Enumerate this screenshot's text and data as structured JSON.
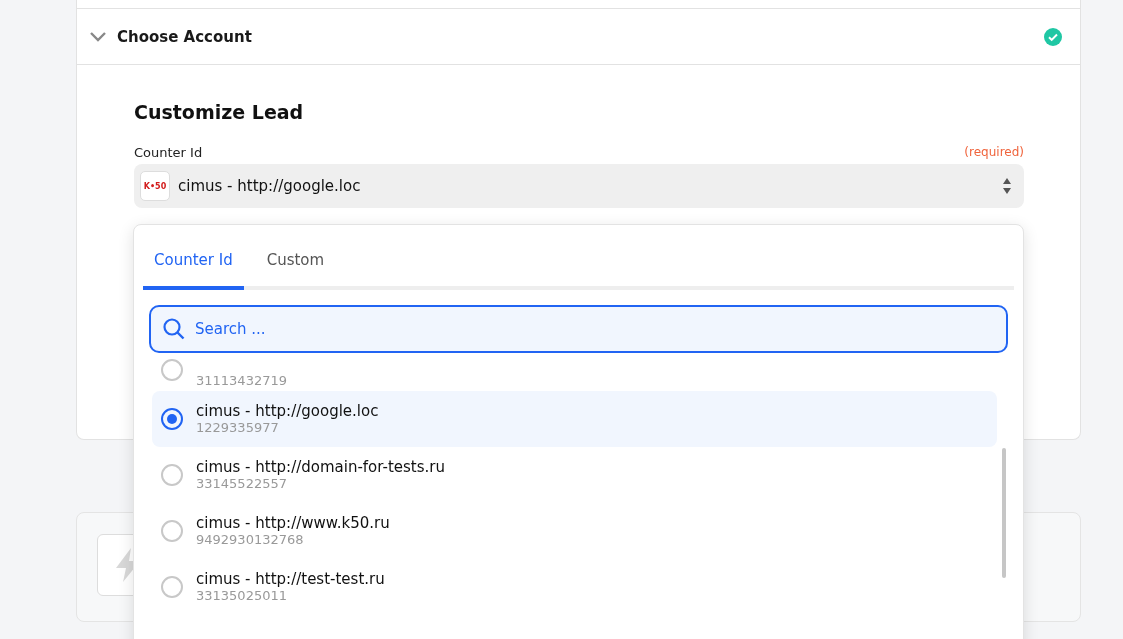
{
  "section": {
    "title": "Choose Account",
    "complete": true
  },
  "form": {
    "title": "Customize Lead",
    "field": {
      "label": "Counter Id",
      "required_note": "(required)",
      "logo_text": "K•50",
      "value": "cimus - http://google.loc"
    }
  },
  "dropdown": {
    "tabs": [
      {
        "label": "Counter Id",
        "selected": true
      },
      {
        "label": "Custom",
        "selected": false
      }
    ],
    "search": {
      "placeholder": "Search ..."
    },
    "options": [
      {
        "id": "31113432719",
        "selected": false
      },
      {
        "name": "cimus - http://google.loc",
        "id": "1229335977",
        "selected": true
      },
      {
        "name": "cimus - http://domain-for-tests.ru",
        "id": "33145522557",
        "selected": false
      },
      {
        "name": "cimus - http://www.k50.ru",
        "id": "9492930132768",
        "selected": false
      },
      {
        "name": "cimus - http://test-test.ru",
        "id": "33135025011",
        "selected": false
      }
    ]
  }
}
